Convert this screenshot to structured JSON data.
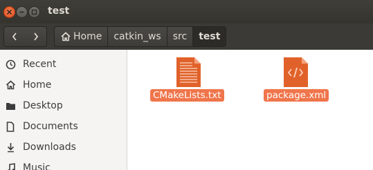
{
  "window": {
    "title": "test"
  },
  "toolbar": {
    "breadcrumbs": [
      "Home",
      "catkin_ws",
      "src",
      "test"
    ]
  },
  "sidebar": {
    "items": [
      {
        "label": "Recent",
        "icon": "clock-icon"
      },
      {
        "label": "Home",
        "icon": "home-icon"
      },
      {
        "label": "Desktop",
        "icon": "folder-icon"
      },
      {
        "label": "Documents",
        "icon": "document-icon"
      },
      {
        "label": "Downloads",
        "icon": "download-icon"
      },
      {
        "label": "Music",
        "icon": "music-icon"
      }
    ]
  },
  "files": [
    {
      "name": "CMakeLists.txt",
      "icon": "text-file-icon"
    },
    {
      "name": "package.xml",
      "icon": "xml-file-icon"
    }
  ],
  "colors": {
    "accent": "#f0754b",
    "icon_orange": "#e0622a",
    "titlebar": "#3b3a36"
  }
}
